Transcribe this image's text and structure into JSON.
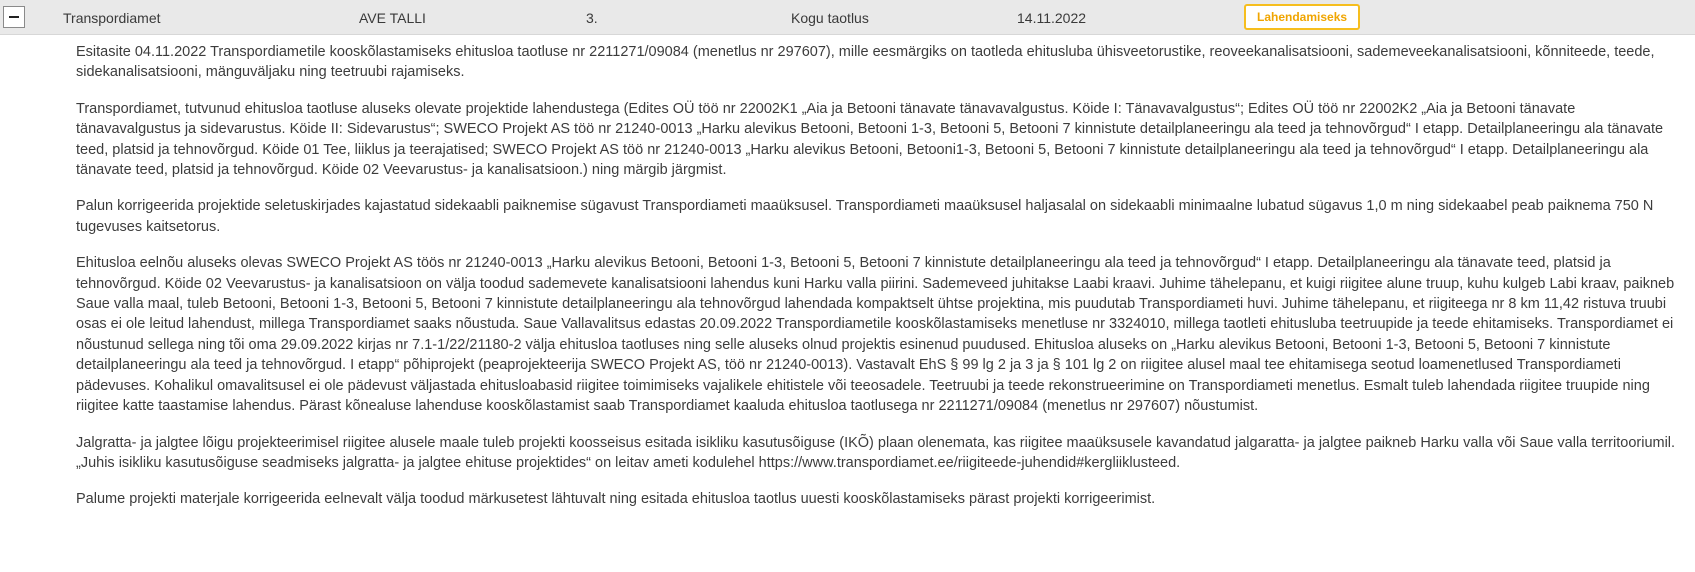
{
  "row": {
    "toggle_symbol": "−",
    "organization": "Transpordiamet",
    "applicant": "AVE TALLI",
    "number": "3.",
    "request_type": "Kogu taotlus",
    "date": "14.11.2022",
    "status": "Lahendamiseks",
    "status_color": "#f6be1e"
  },
  "body": {
    "paragraphs": [
      "Esitasite 04.11.2022 Transpordiametile kooskõlastamiseks ehitusloa taotluse nr 2211271/09084 (menetlus nr 297607), mille eesmärgiks on taotleda ehitusluba ühisveetorustike, reoveekanalisatsiooni, sademeveekanalisatsiooni, kõnniteede, teede, sidekanalisatsiooni, mänguväljaku ning teetruubi rajamiseks.",
      "Transpordiamet, tutvunud ehitusloa taotluse aluseks olevate projektide lahendustega (Edites OÜ töö nr 22002K1 „Aia ja Betooni tänavate tänavavalgustus. Köide I: Tänavavalgustus“; Edites OÜ töö nr 22002K2 „Aia ja Betooni tänavate tänavavalgustus ja sidevarustus. Köide II: Sidevarustus“; SWECO Projekt AS töö nr 21240-0013 „Harku alevikus Betooni, Betooni 1-3, Betooni 5, Betooni 7 kinnistute detailplaneeringu ala teed ja tehnovõrgud“ I etapp. Detailplaneeringu ala tänavate teed, platsid ja tehnovõrgud. Köide 01 Tee, liiklus ja teerajatised; SWECO Projekt AS töö nr 21240-0013 „Harku alevikus Betooni, Betooni1-3, Betooni 5, Betooni 7 kinnistute detailplaneeringu ala teed ja tehnovõrgud“ I etapp. Detailplaneeringu ala tänavate teed, platsid ja tehnovõrgud. Köide 02 Veevarustus- ja kanalisatsioon.) ning märgib järgmist.",
      "Palun korrigeerida projektide seletuskirjades kajastatud sidekaabli paiknemise sügavust Transpordiameti maaüksusel. Transpordiameti maaüksusel haljasalal on sidekaabli minimaalne lubatud sügavus 1,0 m ning sidekaabel peab paiknema 750 N tugevuses kaitsetorus.",
      "Ehitusloa eelnõu aluseks olevas SWECO Projekt AS töös nr 21240-0013 „Harku alevikus Betooni, Betooni 1-3, Betooni 5, Betooni 7 kinnistute detailplaneeringu ala teed ja tehnovõrgud“ I etapp. Detailplaneeringu ala tänavate teed, platsid ja tehnovõrgud. Köide 02 Veevarustus- ja kanalisatsioon on välja toodud sademevete kanalisatsiooni lahendus kuni Harku valla piirini. Sademeveed juhitakse Laabi kraavi. Juhime tähelepanu, et kuigi riigitee alune truup, kuhu kulgeb Labi kraav, paikneb Saue valla maal, tuleb Betooni, Betooni 1-3, Betooni 5, Betooni 7 kinnistute detailplaneeringu ala tehnovõrgud lahendada kompaktselt ühtse projektina, mis puudutab Transpordiameti huvi. Juhime tähelepanu, et riigiteega nr 8 km 11,42 ristuva truubi osas ei ole leitud lahendust, millega Transpordiamet saaks nõustuda.  Saue Vallavalitsus edastas 20.09.2022 Transpordiametile kooskõlastamiseks menetluse nr 3324010, millega taotleti ehitusluba teetruupide ja teede ehitamiseks. Transpordiamet ei nõustunud sellega ning tõi oma 29.09.2022 kirjas nr 7.1-1/22/21180-2 välja ehitusloa taotluses ning selle aluseks olnud projektis esinenud puudused. Ehitusloa aluseks on „Harku alevikus Betooni, Betooni 1-3, Betooni 5, Betooni 7 kinnistute detailplaneeringu ala teed ja tehnovõrgud. I etapp“ põhiprojekt (peaprojekteerija SWECO Projekt AS, töö nr 21240-0013). Vastavalt EhS § 99 lg 2 ja 3 ja § 101 lg 2 on riigitee alusel maal tee ehitamisega seotud loamenetlused Transpordiameti pädevuses. Kohalikul omavalitsusel ei ole pädevust väljastada ehitusloabasid riigitee toimimiseks vajalikele ehitistele või teeosadele. Teetruubi ja teede rekonstrueerimine on Transpordiameti menetlus. Esmalt tuleb lahendada riigitee truupide ning riigitee katte taastamise lahendus. Pärast kõnealuse lahenduse kooskõlastamist saab Transpordiamet kaaluda ehitusloa taotlusega nr 2211271/09084 (menetlus nr 297607) nõustumist.",
      " Jalgratta- ja jalgtee lõigu projekteerimisel riigitee alusele maale tuleb  projekti koosseisus esitada isikliku kasutusõiguse (IKÕ) plaan olenemata, kas riigitee maaüksusele kavandatud jalgaratta- ja jalgtee paikneb Harku valla või Saue valla territooriumil.  „Juhis isikliku kasutusõiguse seadmiseks jalgratta- ja jalgtee ehituse projektides“ on leitav ameti kodulehel https://www.transpordiamet.ee/riigiteede-juhendid#kergliiklusteed.",
      "Palume projekti materjale korrigeerida eelnevalt välja toodud märkusetest lähtuvalt ning esitada ehitusloa taotlus uuesti kooskõlastamiseks pärast projekti korrigeerimist."
    ]
  }
}
